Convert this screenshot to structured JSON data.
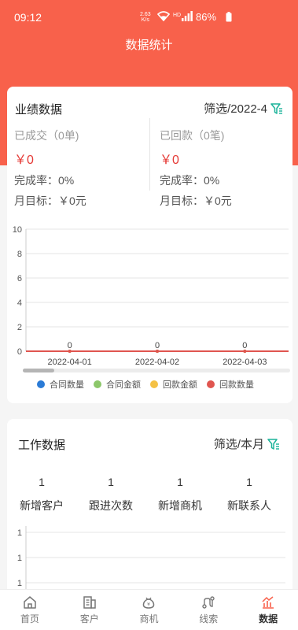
{
  "status_bar": {
    "time": "09:12",
    "speed_value": "2.63",
    "speed_unit": "K/s",
    "network": "HD",
    "battery": "86%"
  },
  "page_title": "数据统计",
  "performance": {
    "title": "业绩数据",
    "filter_label": "筛选/2022-4",
    "left": {
      "label": "已成交（0单)",
      "amount": "￥0",
      "rate": "完成率：0%",
      "target": "月目标：￥0元"
    },
    "right": {
      "label": "已回款（0笔)",
      "amount": "￥0",
      "rate": "完成率：0%",
      "target": "月目标：￥0元"
    }
  },
  "chart_data": {
    "type": "line",
    "categories": [
      "2022-04-01",
      "2022-04-02",
      "2022-04-03"
    ],
    "ylim": [
      0,
      10
    ],
    "yticks": [
      "10",
      "8",
      "6",
      "4",
      "2",
      "0"
    ],
    "series": [
      {
        "name": "合同数量",
        "color": "#2b7bd6",
        "values": [
          0,
          0,
          0
        ]
      },
      {
        "name": "合同金额",
        "color": "#8cc76a",
        "values": [
          0,
          0,
          0
        ]
      },
      {
        "name": "回款金额",
        "color": "#f4c145",
        "values": [
          0,
          0,
          0
        ]
      },
      {
        "name": "回款数量",
        "color": "#e0554f",
        "values": [
          0,
          0,
          0
        ]
      }
    ],
    "data_labels": [
      "0",
      "0",
      "0"
    ],
    "legend": "bottom"
  },
  "work": {
    "title": "工作数据",
    "filter_label": "筛选/本月",
    "stats": [
      {
        "value": "1",
        "label": "新增客户"
      },
      {
        "value": "1",
        "label": "跟进次数"
      },
      {
        "value": "1",
        "label": "新增商机"
      },
      {
        "value": "1",
        "label": "新联系人"
      }
    ],
    "chart_yticks": [
      "1",
      "1",
      "1"
    ]
  },
  "tabbar": [
    {
      "label": "首页",
      "icon": "home-icon"
    },
    {
      "label": "客户",
      "icon": "customer-icon"
    },
    {
      "label": "商机",
      "icon": "opportunity-icon"
    },
    {
      "label": "线索",
      "icon": "clue-icon"
    },
    {
      "label": "数据",
      "icon": "data-icon",
      "active": true
    }
  ],
  "colors": {
    "brand": "#f8614b",
    "accent_teal": "#1bb39a",
    "amount_red": "#e53935"
  }
}
